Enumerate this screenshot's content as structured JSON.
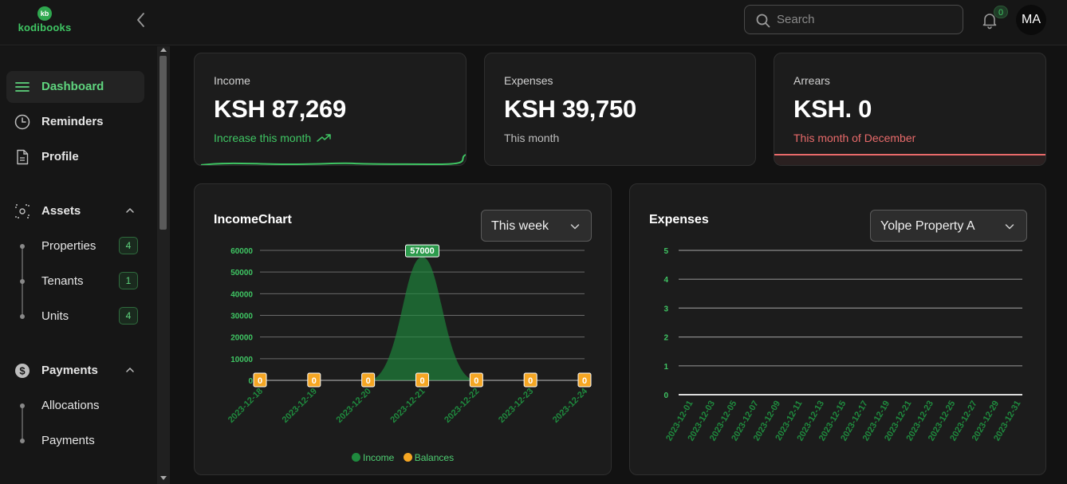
{
  "app": {
    "logo_mark": "kb",
    "logo_text": "kodibooks"
  },
  "header": {
    "search_placeholder": "Search",
    "notifications_count": "0",
    "avatar_initials": "MA"
  },
  "sidebar": {
    "dashboard": "Dashboard",
    "reminders": "Reminders",
    "profile": "Profile",
    "assets": {
      "label": "Assets",
      "items": [
        {
          "label": "Properties",
          "count": "4"
        },
        {
          "label": "Tenants",
          "count": "1"
        },
        {
          "label": "Units",
          "count": "4"
        }
      ]
    },
    "payments": {
      "label": "Payments",
      "items": [
        {
          "label": "Allocations"
        },
        {
          "label": "Payments"
        }
      ]
    }
  },
  "stats": {
    "income": {
      "label": "Income",
      "value": "KSH 87,269",
      "sub": "Increase this month"
    },
    "expenses": {
      "label": "Expenses",
      "value": "KSH 39,750",
      "sub": "This month"
    },
    "arrears": {
      "label": "Arrears",
      "value": "KSH. 0",
      "sub": "This month of December"
    }
  },
  "colors": {
    "accent": "#3fc563",
    "income_series": "#1f8a3e",
    "balances_series": "#f5a623",
    "alert": "#e86a6a"
  },
  "income_chart": {
    "title": "IncomeChart",
    "period": "This week"
  },
  "expenses_chart": {
    "title": "Expenses",
    "property": "Yolpe Property A"
  },
  "chart_data": [
    {
      "type": "area",
      "title": "IncomeChart",
      "x": [
        "2023-12-18",
        "2023-12-19",
        "2023-12-20",
        "2023-12-21",
        "2023-12-22",
        "2023-12-23",
        "2023-12-24"
      ],
      "yticks": [
        0,
        10000,
        20000,
        30000,
        40000,
        50000,
        60000
      ],
      "ylim": [
        0,
        60000
      ],
      "series": [
        {
          "name": "Income",
          "values": [
            0,
            0,
            0,
            57000,
            0,
            0,
            0
          ]
        },
        {
          "name": "Balances",
          "values": [
            0,
            0,
            0,
            0,
            0,
            0,
            0
          ]
        }
      ],
      "annotations": [
        "57000"
      ],
      "legend": "bottom"
    },
    {
      "type": "line",
      "title": "Expenses",
      "x": [
        "2023-12-01",
        "2023-12-03",
        "2023-12-05",
        "2023-12-07",
        "2023-12-09",
        "2023-12-11",
        "2023-12-13",
        "2023-12-15",
        "2023-12-17",
        "2023-12-19",
        "2023-12-21",
        "2023-12-23",
        "2023-12-25",
        "2023-12-27",
        "2023-12-29",
        "2023-12-31"
      ],
      "yticks": [
        0,
        1,
        2,
        3,
        4,
        5
      ],
      "ylim": [
        0,
        5
      ],
      "series": [
        {
          "values": [
            0,
            0,
            0,
            0,
            0,
            0,
            0,
            0,
            0,
            0,
            0,
            0,
            0,
            0,
            0,
            0
          ]
        }
      ]
    }
  ]
}
